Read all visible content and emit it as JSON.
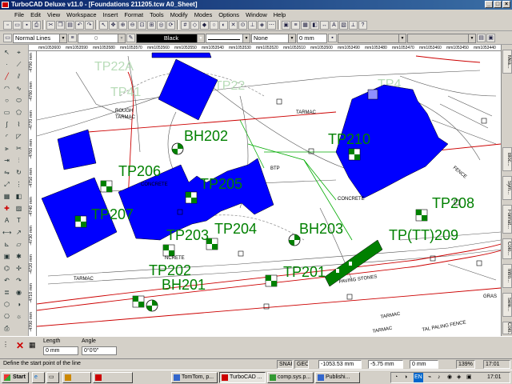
{
  "window": {
    "title": "TurboCAD Deluxe v11.0 - [Foundations 211205.tcw A0_Sheet]"
  },
  "menu": [
    "File",
    "Edit",
    "View",
    "Workspace",
    "Insert",
    "Format",
    "Tools",
    "Modify",
    "Modes",
    "Options",
    "Window",
    "Help"
  ],
  "props": {
    "line_style": "Normal Lines",
    "line_width": "0",
    "pen_color": "Black",
    "fill": "None",
    "size": "0 mm"
  },
  "ruler_h": [
    "mm1053600",
    "mm1053590",
    "mm1053580",
    "mm1053570",
    "mm1053560",
    "mm1053550",
    "mm1053540",
    "mm1053530",
    "mm1053520",
    "mm1053510",
    "mm1053500",
    "mm1053490",
    "mm1053480",
    "mm1053470",
    "mm1053460",
    "mm1053450",
    "mm1053440"
  ],
  "ruler_v": [
    "-4790 mm",
    "-4780 mm",
    "-4770 mm",
    "-4760 mm",
    "-4750 mm",
    "-4740 mm",
    "-4730 mm",
    "-4720 mm",
    "-4710 mm",
    "-4700 mm"
  ],
  "drawing": {
    "faded_labels": [
      "TP22A",
      "TP41",
      "TP22",
      "TP4"
    ],
    "tp_labels": [
      "BH202",
      "TP210",
      "TP206",
      "TP205",
      "TP207",
      "TP208",
      "TP203",
      "TP204",
      "BH203",
      "TP(TT)209",
      "TP202",
      "BH201",
      "TP201"
    ],
    "annotations": [
      "ROUGH",
      "TARMAC",
      "TARMAC",
      "CONCRETE",
      "NCRETE",
      "TARMAC",
      "PAVING STONES",
      "TARMAC",
      "CONCRETE",
      "GRAS",
      "TARMAC",
      "TAL PALING FENCE",
      "FENCE",
      "BTP"
    ],
    "colors": {
      "building": "#0000ff",
      "marker": "#008000",
      "road": "#cc0000",
      "line": "#000000"
    }
  },
  "right_tabs": [
    "Mea...",
    "Bloc...",
    "Sym...",
    "Format...",
    "Colo...",
    "Intro...",
    "Sele...",
    "Colo...",
    "ToP"
  ],
  "inspector": {
    "length_label": "Length",
    "length_value": "0 mm",
    "angle_label": "Angle",
    "angle_value": "0°0'0\""
  },
  "status": {
    "prompt": "Define the start point of the line",
    "snap": "SNAP",
    "geo": "GEO",
    "x": "-1053.53 mm",
    "y": "-5.75 mm",
    "z": "0 mm",
    "zoom": "139%",
    "clock_status": "17:01"
  },
  "taskbar": {
    "start": "Start",
    "tasks": [
      "",
      "TomTom, p...",
      "TurboCAD ...",
      "comp.sys.p...",
      "Publishi..."
    ],
    "tray_lang": "EN",
    "clock": "17:01"
  }
}
